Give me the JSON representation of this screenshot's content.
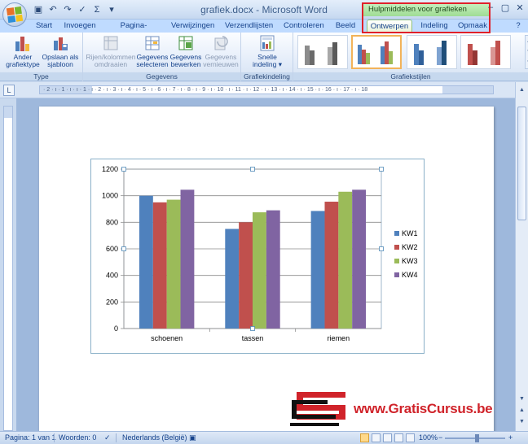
{
  "window": {
    "document_name": "grafiek.docx",
    "separator": " - ",
    "app_name": "Microsoft Word",
    "context_group_label": "Hulpmiddelen voor grafieken",
    "controls": [
      "–",
      "▢",
      "✕"
    ]
  },
  "quick_access": {
    "icons": [
      "save-icon",
      "undo-icon",
      "redo-icon",
      "spelling-icon",
      "sigma-icon",
      "dropdown-icon"
    ]
  },
  "tabs": [
    {
      "label": "Start"
    },
    {
      "label": "Invoegen"
    },
    {
      "label": "Pagina-indeling"
    },
    {
      "label": "Verwijzingen"
    },
    {
      "label": "Verzendlijsten"
    },
    {
      "label": "Controleren"
    },
    {
      "label": "Beeld"
    },
    {
      "label": "Ontwerpen",
      "active": true
    },
    {
      "label": "Indeling"
    },
    {
      "label": "Opmaak"
    }
  ],
  "ribbon": {
    "groups": [
      {
        "label": "Type",
        "buttons": [
          {
            "label_1": "Ander",
            "label_2": "grafiektype",
            "enabled": true
          },
          {
            "label_1": "Opslaan als",
            "label_2": "sjabloon",
            "enabled": true
          }
        ]
      },
      {
        "label": "Gegevens",
        "buttons": [
          {
            "label_1": "Rijen/kolommen",
            "label_2": "omdraaien",
            "enabled": false
          },
          {
            "label_1": "Gegevens",
            "label_2": "selecteren",
            "enabled": true
          },
          {
            "label_1": "Gegevens",
            "label_2": "bewerken",
            "enabled": true
          },
          {
            "label_1": "Gegevens",
            "label_2": "vernieuwen",
            "enabled": false
          }
        ]
      },
      {
        "label": "Grafiekindeling",
        "buttons": [
          {
            "label_1": "Snelle",
            "label_2": "indeling ▾",
            "enabled": true
          }
        ]
      },
      {
        "label": "Grafiekstijlen",
        "styles": [
          {
            "colors": [
              "#8c8c8c",
              "#6a6a6a",
              "#a8a8a8",
              "#5a5a5a"
            ]
          },
          {
            "colors": [
              "#4f81bd",
              "#c0504d",
              "#9bbb59",
              "#8064a2"
            ],
            "selected": true
          },
          {
            "colors": [
              "#4f81bd",
              "#2f5f99",
              "#7fa3d1",
              "#1f4e79"
            ]
          },
          {
            "colors": [
              "#c0504d",
              "#943634",
              "#d99694",
              "#e6b9b8"
            ]
          }
        ]
      }
    ]
  },
  "ruler": {
    "corner_icon": "tab-stop-icon",
    "text": "· 2 · ı · 1 · ı · ı · 1 · ı · 2 · ı · 3 · ı · 4 · ı · 5 · ı · 6 · ı · 7 · ı · 8 · ı · 9 · ı · 10 · ı · 11 · ı · 12 · ı · 13 · ı · 14 · ı · 15 · ı · 16 · ı · 17 · ı · 18"
  },
  "chart_data": {
    "type": "bar",
    "categories": [
      "schoenen",
      "tassen",
      "riemen"
    ],
    "series": [
      {
        "name": "KW1",
        "color": "#4f81bd",
        "values": [
          1000,
          750,
          885
        ]
      },
      {
        "name": "KW2",
        "color": "#c0504d",
        "values": [
          950,
          800,
          955
        ]
      },
      {
        "name": "KW3",
        "color": "#9bbb59",
        "values": [
          970,
          875,
          1030
        ]
      },
      {
        "name": "KW4",
        "color": "#8064a2",
        "values": [
          1045,
          890,
          1045
        ]
      }
    ],
    "ylim": [
      0,
      1200
    ],
    "yticks": [
      0,
      200,
      400,
      600,
      800,
      1000,
      1200
    ],
    "grid": true,
    "legend": "right"
  },
  "watermark": {
    "text": "www.GratisCursus.be"
  },
  "status": {
    "page": "Pagina: 1 van 1",
    "words": "Woorden: 0",
    "language": "Nederlands (België)",
    "zoom": "100%",
    "zoom_minus": "−",
    "zoom_plus": "+"
  },
  "colors": {
    "accent_green": "#9fdc94",
    "highlight_red": "#e0202a",
    "ribbon_blue": "#bfdbff"
  }
}
